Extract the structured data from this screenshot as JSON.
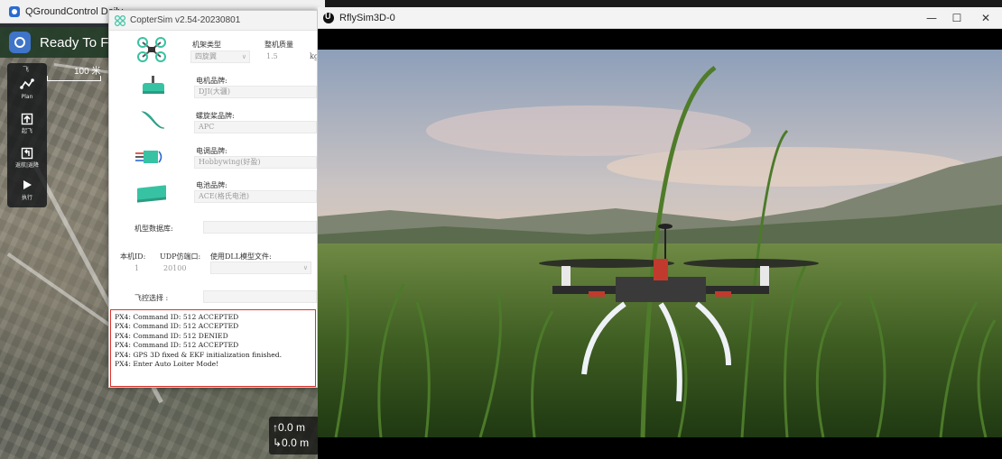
{
  "qgc": {
    "title": "QGroundControl Daily",
    "status": "Ready To Fly",
    "scale_label": "100 米",
    "tools": [
      {
        "label": "Plan",
        "icon": "plan-icon"
      },
      {
        "label": "起飞",
        "icon": "takeoff-icon"
      },
      {
        "label": "返航|返降",
        "icon": "return-icon"
      },
      {
        "label": "执行",
        "icon": "play-icon"
      }
    ],
    "altitude": "↑0.0 m",
    "distance": "↳0.0 m"
  },
  "coptersim": {
    "title": "CopterSim v2.54-20230801",
    "frame_type_label": "机架类型",
    "frame_type_value": "四旋翼",
    "mass_label": "整机质量",
    "mass_value": "1.5",
    "mass_unit": "kg",
    "motor_label": "电机品牌:",
    "motor_value": "DJI(大疆)",
    "propeller_label": "螺旋桨品牌:",
    "propeller_value": "APC",
    "esc_label": "电调品牌:",
    "esc_value": "Hobbywing(好盈)",
    "battery_label": "电池品牌:",
    "battery_value": "ACE(格氏电池)",
    "database_label": "机型数据库:",
    "database_value": "",
    "id_label": "本机ID:",
    "id_value": "1",
    "udp_label": "UDP仿端口:",
    "udp_value": "20100",
    "dll_label": "使用DLL模型文件:",
    "dll_value": "",
    "fc_label": "飞控选择 :",
    "fc_value": "",
    "log_lines": [
      "PX4: Command ID: 512 ACCEPTED",
      "PX4: Command ID: 512 ACCEPTED",
      "PX4: Command ID: 512 DENIED",
      "PX4: Command ID: 512 ACCEPTED",
      "PX4: GPS 3D fixed & EKF initialization finished.",
      "PX4: Enter Auto Loiter Mode!"
    ]
  },
  "rflysim": {
    "title": "RflySim3D-0",
    "minimize": "—",
    "maximize": "☐",
    "close": "✕"
  },
  "colors": {
    "accent": "#d9332b",
    "qgc_toolbar": "#233c28",
    "rotor_green": "#37c3a3"
  }
}
